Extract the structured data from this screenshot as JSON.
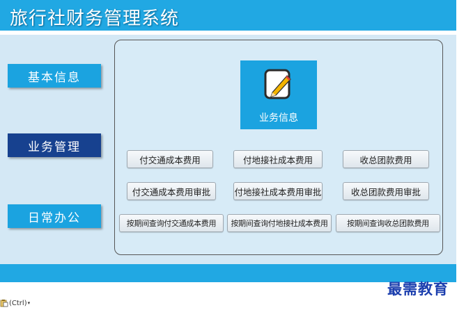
{
  "app": {
    "title": "旅行社财务管理系统"
  },
  "nav": {
    "items": [
      {
        "label": "基本信息"
      },
      {
        "label": "业务管理"
      },
      {
        "label": "日常办公"
      }
    ]
  },
  "tile": {
    "label": "业务信息",
    "icon": "document-edit-icon"
  },
  "buttons": {
    "row1": [
      "付交通成本费用",
      "付地接社成本费用",
      "收总团款费用"
    ],
    "row2": [
      "付交通成本费用审批",
      "付地接社成本费用审批",
      "收总团款费用审批"
    ],
    "row3": [
      "按期间查询付交通成本费用",
      "按期间查询付地接社成本费用",
      "按期间查询收总团款费用"
    ]
  },
  "watermark": "最需教育",
  "clipboard": {
    "label": "(Ctrl)",
    "icon": "paste-options-icon"
  },
  "colors": {
    "accent": "#21a8e3",
    "active_nav": "#17418f",
    "background": "#d4e8f5"
  }
}
